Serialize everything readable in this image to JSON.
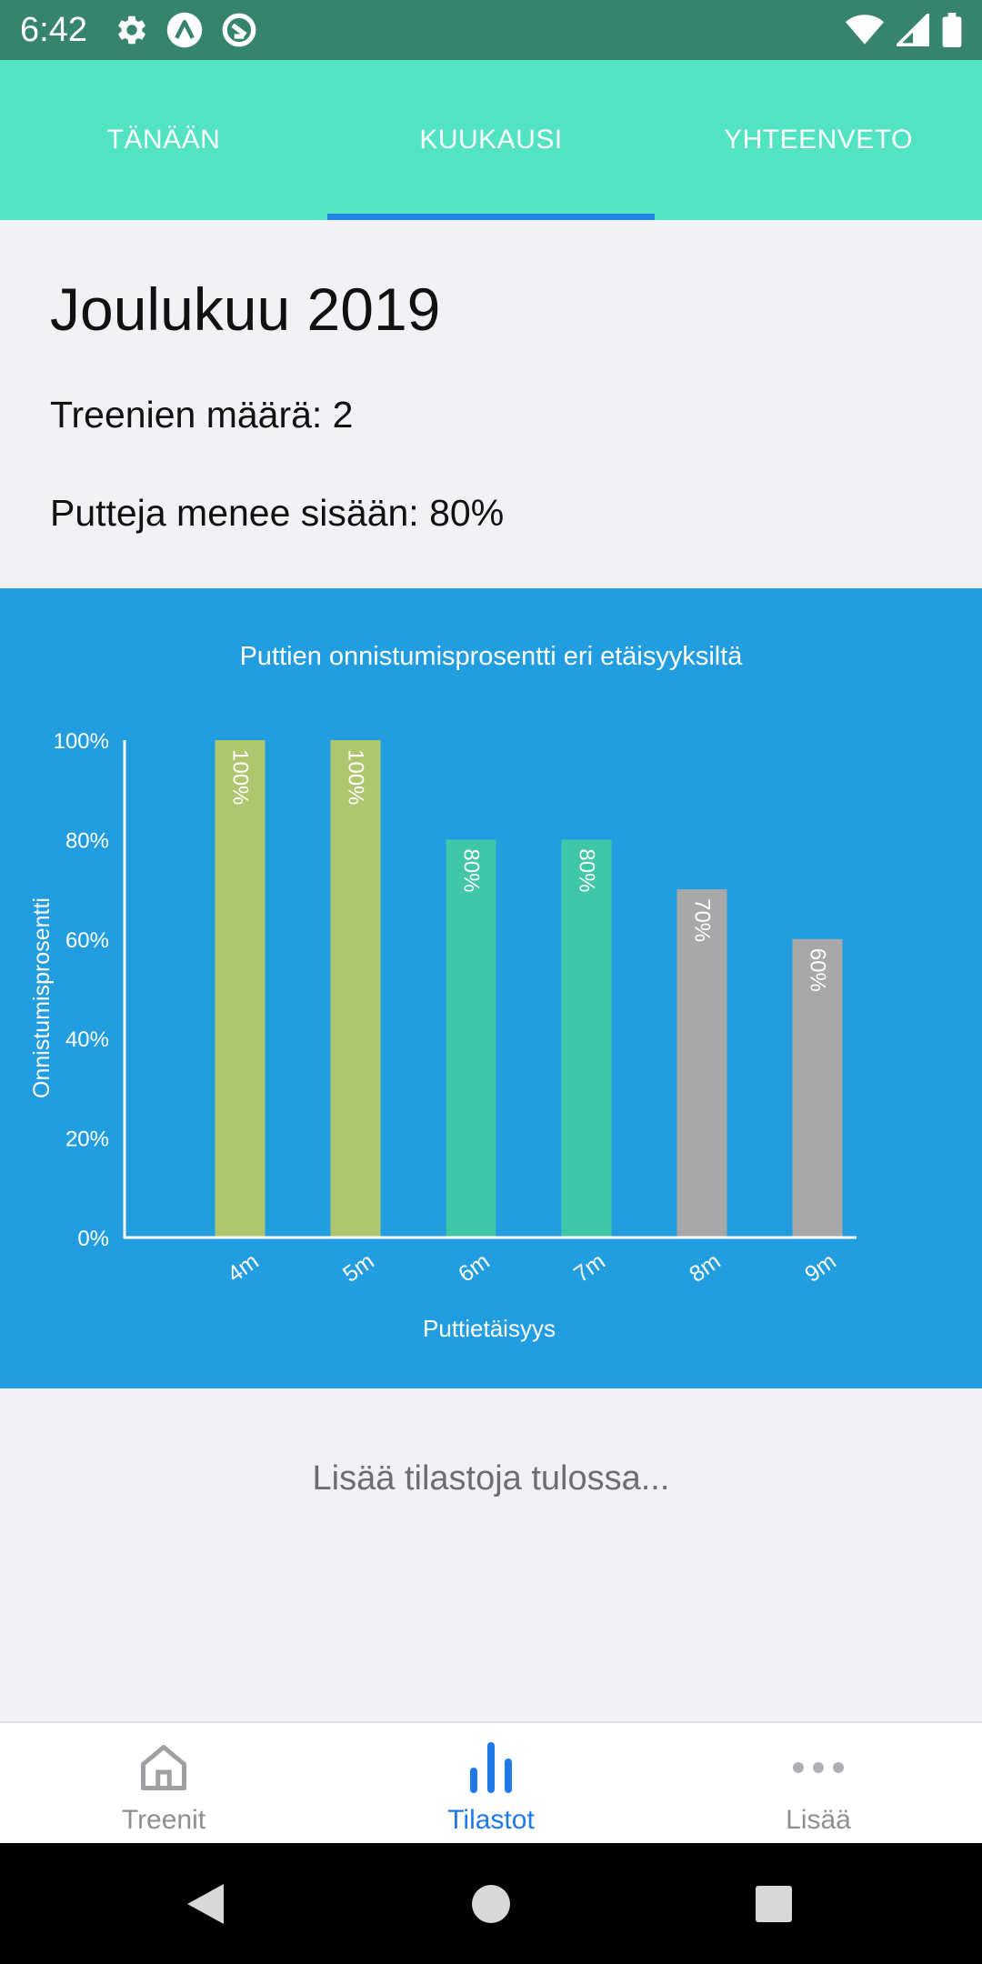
{
  "status_bar": {
    "time": "6:42",
    "icons": [
      "gear-icon",
      "expo-icon",
      "sync-icon",
      "wifi-icon",
      "signal-icon",
      "battery-icon"
    ]
  },
  "top_tabs": [
    {
      "label": "TÄNÄÄN",
      "active": false
    },
    {
      "label": "KUUKAUSI",
      "active": true
    },
    {
      "label": "YHTEENVETO",
      "active": false
    }
  ],
  "summary": {
    "month": "Joulukuu 2019",
    "workouts": "Treenien määrä: 2",
    "putts_in": "Putteja menee sisään: 80%"
  },
  "chart_data": {
    "type": "bar",
    "title": "Puttien onnistumisprosentti eri etäisyyksiltä",
    "xlabel": "Puttietäisyys",
    "ylabel": "Onnistumisprosentti",
    "categories": [
      "4m",
      "5m",
      "6m",
      "7m",
      "8m",
      "9m"
    ],
    "values": [
      100,
      100,
      80,
      80,
      70,
      60
    ],
    "value_labels": [
      "100%",
      "100%",
      "80%",
      "80%",
      "70%",
      "60%"
    ],
    "bar_colors": [
      "#aec66e",
      "#aec66e",
      "#40c7a8",
      "#40c7a8",
      "#a8a8a8",
      "#a8a8a8"
    ],
    "ylim": [
      0,
      100
    ],
    "yticks": [
      "0%",
      "20%",
      "40%",
      "60%",
      "80%",
      "100%"
    ],
    "grid": false,
    "background": "#229de0"
  },
  "more_stats": "Lisää tilastoja tulossa...",
  "bottom_nav": [
    {
      "label": "Treenit",
      "icon": "home-icon",
      "active": false
    },
    {
      "label": "Tilastot",
      "icon": "bar-chart-icon",
      "active": true
    },
    {
      "label": "Lisää",
      "icon": "more-icon",
      "active": false
    }
  ],
  "colors": {
    "status_bar": "#36846e",
    "tab_bar": "#52e3c2",
    "tab_indicator": "#2286e6",
    "active_nav": "#2079e6",
    "inactive_nav": "#8e8e93"
  }
}
